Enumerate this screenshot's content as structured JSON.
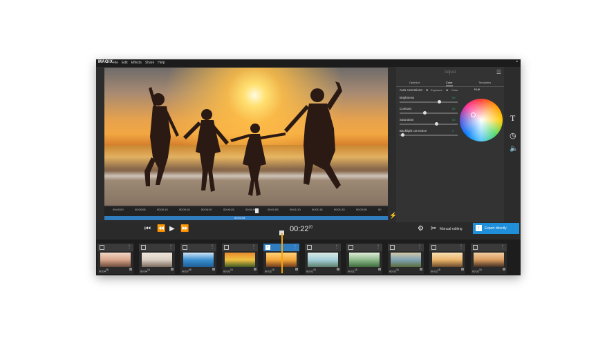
{
  "app": {
    "logo": "MAGIX",
    "menu": [
      "File",
      "Edit",
      "Effects",
      "Share",
      "Help"
    ],
    "close": "▪"
  },
  "ruler": {
    "ticks": [
      "00:00:00",
      "00:00:05",
      "00:00:10",
      "00:00:15",
      "00:00:20",
      "00:00:25",
      "00:01:00",
      "00:01:05",
      "00:01:10",
      "00:01:15",
      "00:01:20",
      "00:02:00",
      "00"
    ],
    "position_label": "00:01:06"
  },
  "transport": {
    "skip_start": "⏮",
    "rewind": "⏪",
    "play": "▶",
    "forward": "⏩",
    "timecode": "00:22",
    "timecode_frames": "20",
    "manual_editing": "Manual editing",
    "export_directly": "Export directly"
  },
  "panel": {
    "title": "Adjust",
    "tabs": [
      "Optimize",
      "Color",
      "Templates"
    ],
    "active_tab": "Color",
    "auto_corrections": "Auto corrections:",
    "exposure": "Exposure",
    "color": "Color",
    "hue": "Hue",
    "controls": [
      {
        "label": "Brightness",
        "value": "50",
        "level": 0.68
      },
      {
        "label": "Contrast",
        "value": "50",
        "level": 0.43
      },
      {
        "label": "Saturation",
        "value": "50",
        "level": 0.63
      },
      {
        "label": "Backlight correction",
        "value": "0",
        "level": 0.05
      }
    ]
  },
  "storyboard": {
    "clips": [
      {
        "duration": "00:04",
        "frames": "05",
        "selected": false,
        "colors": [
          "#d7a58a",
          "#6b4a3a",
          "#f1d7c6"
        ]
      },
      {
        "duration": "00:04",
        "frames": "15",
        "selected": false,
        "colors": [
          "#d9cfc2",
          "#7b6a5d",
          "#efe6dc"
        ]
      },
      {
        "duration": "00:07",
        "frames": "05",
        "selected": false,
        "colors": [
          "#3b8fd0",
          "#1e5f96",
          "#cfe5f5"
        ]
      },
      {
        "duration": "00:02",
        "frames": "15",
        "selected": false,
        "colors": [
          "#f0c142",
          "#3e5b24",
          "#e88b2c"
        ]
      },
      {
        "duration": "00:02",
        "frames": "15",
        "selected": true,
        "colors": [
          "#f3a63a",
          "#6e3a1d",
          "#ffd27a"
        ]
      },
      {
        "duration": "00:01",
        "frames": "15",
        "selected": false,
        "colors": [
          "#a3cfd9",
          "#5c7e6a",
          "#dbe9e2"
        ]
      },
      {
        "duration": "00:01",
        "frames": "15",
        "selected": false,
        "colors": [
          "#8db98a",
          "#3e6b3a",
          "#e1ecd9"
        ]
      },
      {
        "duration": "00:02",
        "frames": "15",
        "selected": false,
        "colors": [
          "#7ea2b5",
          "#5a6c3a",
          "#d2c8a7"
        ]
      },
      {
        "duration": "00:02",
        "frames": "15",
        "selected": false,
        "colors": [
          "#ebb56a",
          "#6a4a2c",
          "#f7dfb5"
        ]
      },
      {
        "duration": "00:02",
        "frames": "15",
        "selected": false,
        "colors": [
          "#d89a5e",
          "#3e2e24",
          "#f2cfa1"
        ]
      }
    ]
  },
  "side_tools": {
    "text": "T",
    "clock": "◷",
    "speaker": "🔈"
  }
}
